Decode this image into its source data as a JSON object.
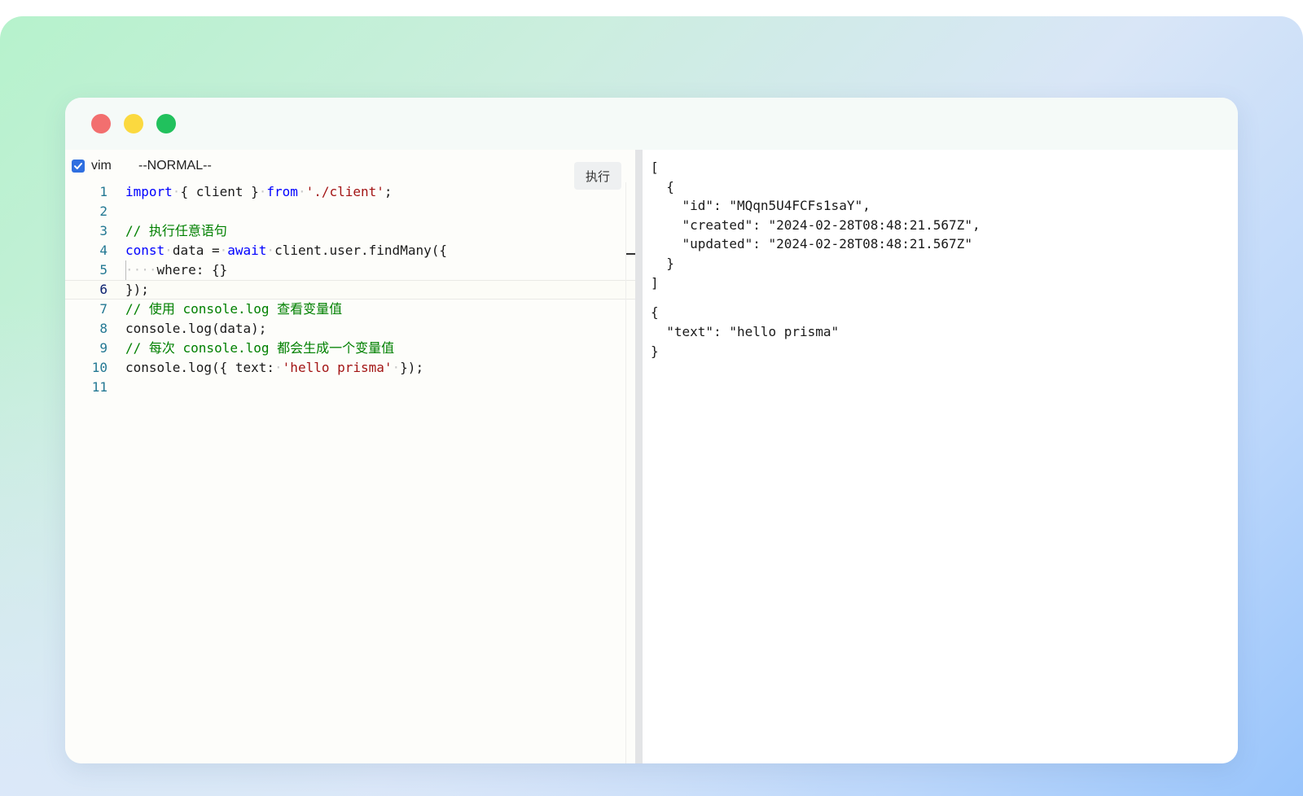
{
  "toolbar": {
    "vim_label": "vim",
    "vim_checked": true,
    "mode": "--NORMAL--",
    "run_label": "执行"
  },
  "editor": {
    "current_line": 6,
    "lines": [
      {
        "n": "1"
      },
      {
        "n": "2"
      },
      {
        "n": "3",
        "comment": "// 执行任意语句"
      },
      {
        "n": "4"
      },
      {
        "n": "5"
      },
      {
        "n": "6"
      },
      {
        "n": "7",
        "comment": "// 使用 console.log 查看变量值"
      },
      {
        "n": "8",
        "text": "console.log(data);"
      },
      {
        "n": "9",
        "comment": "// 每次 console.log 都会生成一个变量值"
      },
      {
        "n": "10"
      },
      {
        "n": "11"
      }
    ],
    "tokens": {
      "import": "import",
      "client_brace": "{ client }",
      "from": "from",
      "path": "'./client'",
      "semi": ";",
      "const": "const",
      "data_eq": "data =",
      "await": "await",
      "find_many": "client.user.findMany({",
      "where": "where: {}",
      "close": "});",
      "log_open": "console.log({ text:",
      "hello": "'hello prisma'",
      "log_close": "});"
    }
  },
  "output": {
    "block1": "[\n  {\n    \"id\": \"MQqn5U4FCFs1saY\",\n    \"created\": \"2024-02-28T08:48:21.567Z\",\n    \"updated\": \"2024-02-28T08:48:21.567Z\"\n  }\n]",
    "block2": "{\n  \"text\": \"hello prisma\"\n}"
  },
  "colors": {
    "keyword": "#0000ff",
    "string": "#a31515",
    "comment": "#008000",
    "line_number": "#237893",
    "checkbox": "#2f6fe0",
    "traffic_red": "#f26f6f",
    "traffic_yellow": "#fbd93f",
    "traffic_green": "#21c15d"
  }
}
